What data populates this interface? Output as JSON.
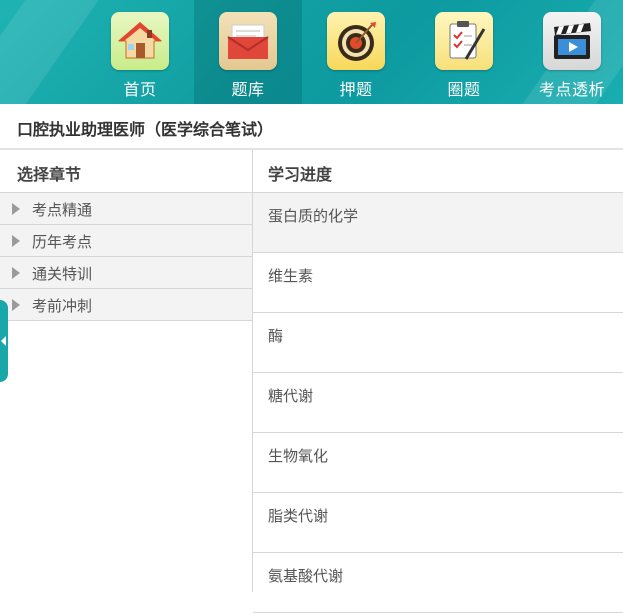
{
  "nav": {
    "items": [
      {
        "label": "首页",
        "icon": "house-icon"
      },
      {
        "label": "题库",
        "icon": "envelope-icon"
      },
      {
        "label": "押题",
        "icon": "target-icon"
      },
      {
        "label": "圈题",
        "icon": "clipboard-pen-icon"
      },
      {
        "label": "考点透析",
        "icon": "clapperboard-icon"
      }
    ],
    "active_index": 1
  },
  "page_title": "口腔执业助理医师（医学综合笔试）",
  "left": {
    "header": "选择章节",
    "chapters": [
      "考点精通",
      "历年考点",
      "通关特训",
      "考前冲刺"
    ]
  },
  "right": {
    "header": "学习进度",
    "topics": [
      "蛋白质的化学",
      "维生素",
      "酶",
      "糖代谢",
      "生物氧化",
      "脂类代谢",
      "氨基酸代谢"
    ]
  },
  "colors": {
    "nav_bg": "#12a0a3",
    "accent": "#1aa7aa",
    "row_highlight": "#f3f3f3",
    "divider": "#d6d6d6"
  }
}
